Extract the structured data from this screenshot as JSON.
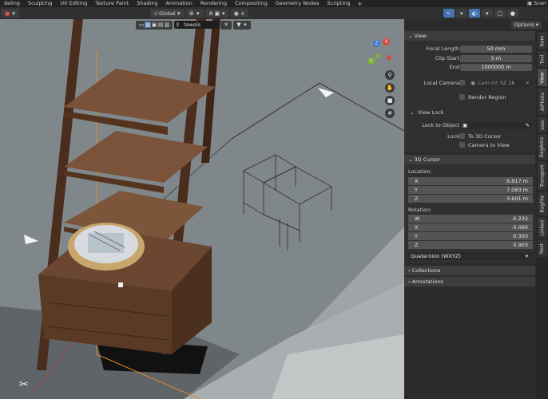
{
  "menubar": {
    "tabs": [
      "deling",
      "Sculpting",
      "UV Editing",
      "Texture Paint",
      "Shading",
      "Animation",
      "Rendering",
      "Compositing",
      "Geometry Nodes",
      "Scripting",
      "+"
    ],
    "scene_label": "Scen"
  },
  "header": {
    "orientation": "Global",
    "options_label": "Options",
    "search_value": "towels"
  },
  "view_panel": {
    "title": "View",
    "focal_length_label": "Focal Length",
    "focal_length_value": "50 mm",
    "clip_start_label": "Clip Start",
    "clip_start_value": "5 m",
    "end_label": "End",
    "end_value": "1000000 m",
    "local_camera_label": "Local Camera",
    "local_camera_value": "Cam Int SZ 2b",
    "render_region_label": "Render Region",
    "view_lock_title": "View Lock",
    "lock_to_object_label": "Lock to Object",
    "lock_label": "Lock",
    "to_3d_cursor_label": "To 3D Cursor",
    "camera_to_view_label": "Camera to View"
  },
  "cursor_panel": {
    "title": "3D Cursor",
    "location_label": "Location:",
    "location": [
      {
        "axis": "X",
        "value": "6.817 m"
      },
      {
        "axis": "Y",
        "value": "7.083 m"
      },
      {
        "axis": "Z",
        "value": "3.601 m"
      }
    ],
    "rotation_label": "Rotation:",
    "rotation": [
      {
        "axis": "W",
        "value": "-0.232"
      },
      {
        "axis": "X",
        "value": "-0.090"
      },
      {
        "axis": "Y",
        "value": "0.350"
      },
      {
        "axis": "Z",
        "value": "0.903"
      }
    ],
    "rotation_mode": "Quaternion (WXYZ)"
  },
  "collections_label": "Collections",
  "annotations_label": "Annotations",
  "vertical_tabs": [
    "Item",
    "Tool",
    "View",
    "AIPhoto",
    "osm",
    "BagArea",
    "Transport",
    "BagFile",
    "Linked",
    "Rest"
  ],
  "gizmo": {
    "x": "X",
    "y": "Y",
    "z": "Z"
  },
  "colors": {
    "accent": "#4772b3",
    "panel_bg": "#303030",
    "field_bg": "#545454",
    "viewport_bg": "#7a8285"
  }
}
